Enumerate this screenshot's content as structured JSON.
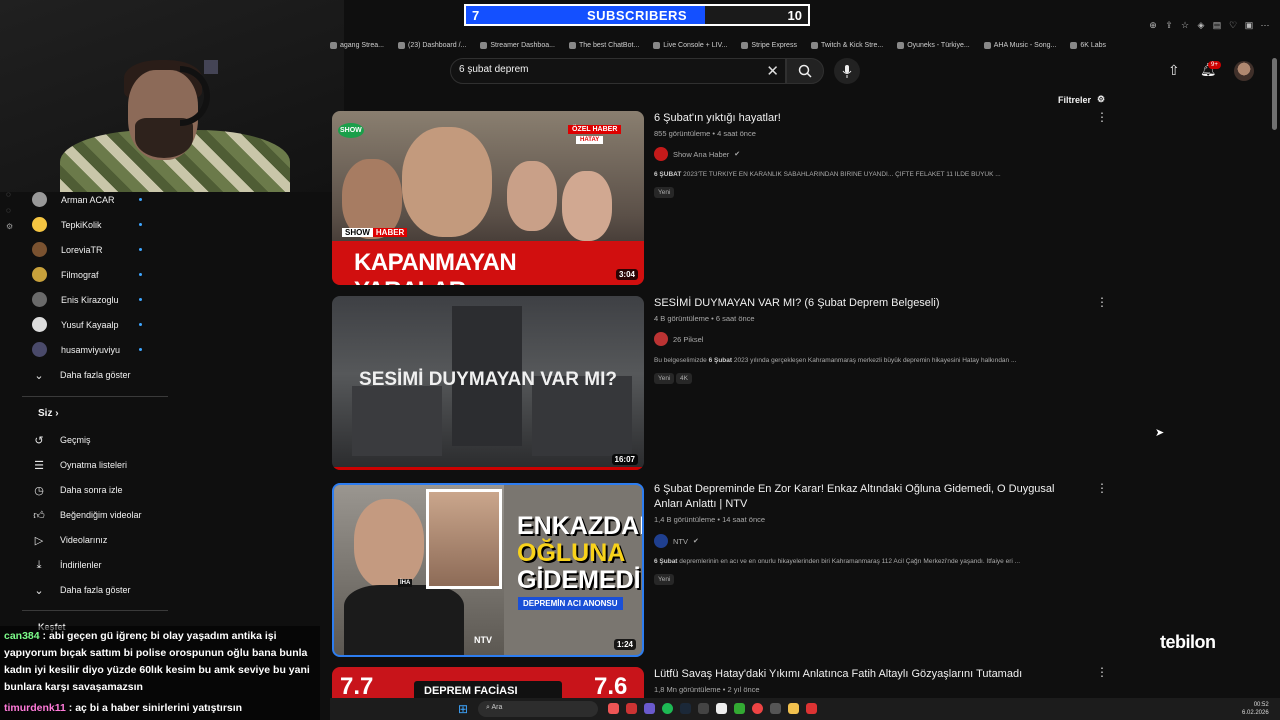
{
  "overlay": {
    "subscriber_goal": {
      "current": "7",
      "label": "SUBSCRIBERS",
      "target": "10",
      "progress_fraction": 0.7
    },
    "watermark": "tebilon",
    "chat": [
      {
        "user": "can384",
        "message": " : abi geçen gü iğrenç bi olay yaşadım antika işi yapıyorum bıçak sattım bi polise orospunun oğlu bana bunla kadın iyi kesilir diyo yüzde 60lık kesim bu amk seviye bu yani bunlara karşı savaşamazsın"
      },
      {
        "user": "timurdenk11",
        "message": " : aç bi a haber sinirlerini yatıştırsın"
      }
    ]
  },
  "bookmarks": [
    "agang Strea...",
    "(23) Dashboard /...",
    "Streamer Dashboa...",
    "The best ChatBot...",
    "Live Console + LIV...",
    "Stripe Express",
    "Twitch & Kick Stre...",
    "Oyuneks - Türkiye...",
    "AHA Music - Song...",
    "6K Labs"
  ],
  "header": {
    "search_value": "6 şubat deprem",
    "notification_count": "9+",
    "filters_label": "Filtreler"
  },
  "sidebar": {
    "subscriptions": [
      "Arman ACAR",
      "TepkiKolik",
      "LoreviaTR",
      "Filmograf",
      "Enis Kirazoglu",
      "Yusuf Kayaalp",
      "husamviyuviyu"
    ],
    "show_more": "Daha fazla göster",
    "you_section": "Siz",
    "you_items": [
      "Geçmiş",
      "Oynatma listeleri",
      "Daha sonra izle",
      "Beğendiğim videolar",
      "Videolarınız",
      "İndirilenler"
    ],
    "show_more_2": "Daha fazla göster",
    "explore": "Keşfet"
  },
  "results": [
    {
      "title": "6 Şubat'ın yıktığı hayatlar!",
      "meta": "855 görüntüleme • 4 saat önce",
      "channel": "Show Ana Haber",
      "verified": true,
      "desc_bold": "6 ŞUBAT",
      "desc": " 2023'TE TÜRKİYE EN KARANLIK SABAHLARINDAN BİRİNE UYANDI... ÇİFTE FELAKET 11 İLDE BÜYÜK ...",
      "badges": [
        "Yeni"
      ],
      "duration": "3:04",
      "thumb_text": "KAPANMAYAN YARALAR...",
      "thumb_logo_1": "SHOW",
      "thumb_logo_2": "HABER",
      "thumb_tag_1": "ÖZEL HABER",
      "thumb_tag_2": "HATAY"
    },
    {
      "title": "SESİMİ DUYMAYAN VAR MI? (6 Şubat Deprem Belgeseli)",
      "meta": "4 B görüntüleme • 6 saat önce",
      "channel": "26 Piksel",
      "verified": false,
      "desc_pre": "Bu belgeselimizde ",
      "desc_bold": "6 Şubat",
      "desc": " 2023 yılında gerçekleşen Kahramanmaraş merkezli büyük depremin hikayesini Hatay halkından ...",
      "badges": [
        "Yeni",
        "4K"
      ],
      "duration": "16:07",
      "thumb_text": "SESİMİ DUYMAYAN VAR MI?"
    },
    {
      "title": "6 Şubat Depreminde En Zor Karar! Enkaz Altındaki Oğluna Gidemedi, O Duygusal Anları Anlattı | NTV",
      "meta": "1,4 B görüntüleme • 14 saat önce",
      "channel": "NTV",
      "verified": true,
      "desc_bold": "6 Şubat",
      "desc": " depremlerinin en acı ve en onurlu hikayelerinden biri Kahramanmaraş 112 Acil Çağrı Merkezi'nde yaşandı. İtfaiye eri ...",
      "badges": [
        "Yeni"
      ],
      "duration": "1:24",
      "thumb_text_1": "ENKAZDAKİ",
      "thumb_text_2": "OĞLUNA",
      "thumb_text_3": "GİDEMEDİ",
      "thumb_sub": "DEPREMİN ACI ANONSU",
      "thumb_logo_1": "NTV",
      "thumb_logo_2": "İHA"
    },
    {
      "title": "Lütfü Savaş Hatay'daki Yıkımı Anlatınca Fatih Altaylı Gözyaşlarını Tutamadı",
      "meta": "1,8 Mn görüntüleme • 2 yıl önce",
      "thumb_left": "7.7",
      "thumb_mid": "DEPREM FACİASI",
      "thumb_right": "7.6"
    }
  ],
  "taskbar": {
    "search": "Ara",
    "time": "00:52",
    "date": "6.02.2026"
  },
  "colors": {
    "background": "#0f0f0f",
    "accent_blue": "#1450ff",
    "verified_gray": "#aaaaaa",
    "notification_red": "#cc0000"
  }
}
